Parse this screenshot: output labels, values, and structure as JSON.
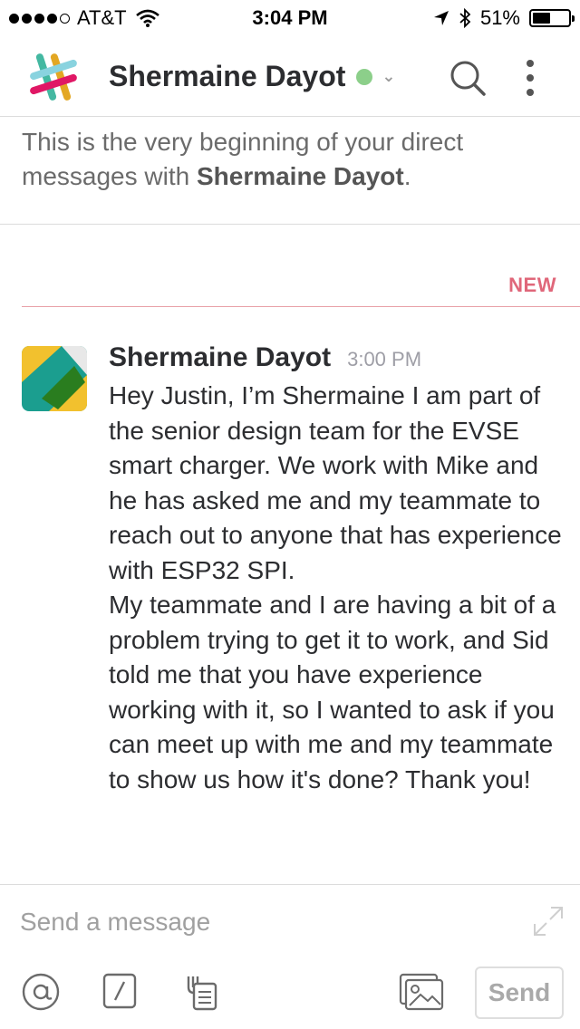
{
  "status_bar": {
    "carrier": "AT&T",
    "time": "3:04 PM",
    "battery": "51%",
    "battery_level": 0.51,
    "signal_bars": 4
  },
  "header": {
    "title": "Shermaine Dayot",
    "presence": "online",
    "presence_color": "#8ccf8a"
  },
  "intro": {
    "text": "This is the very beginning of your direct messages with ",
    "name": "Shermaine Dayot",
    "end": "."
  },
  "divider": {
    "label": "NEW",
    "color": "#e0677a"
  },
  "message": {
    "sender": "Shermaine Dayot",
    "time": "3:00 PM",
    "paragraphs": [
      "Hey Justin, I’m Shermaine I am part of the senior design team for the EVSE smart charger. We work with Mike and he has asked me and my teammate to reach out to anyone that has experience with ESP32 SPI.",
      "My teammate and I are having a bit of a problem trying to get it to work, and Sid told me that you have experience working with it, so I wanted to ask if you can meet up with me and my teammate to show us how it's done? Thank you!"
    ]
  },
  "composer": {
    "placeholder": "Send a message",
    "send_label": "Send"
  },
  "icons": [
    "signal-icon",
    "wifi-icon",
    "location-arrow-icon",
    "bluetooth-icon",
    "battery-icon",
    "slack-logo-icon",
    "search-icon",
    "more-options-icon",
    "expand-icon",
    "at-mention-icon",
    "slash-command-icon",
    "file-upload-icon",
    "photo-icon"
  ]
}
